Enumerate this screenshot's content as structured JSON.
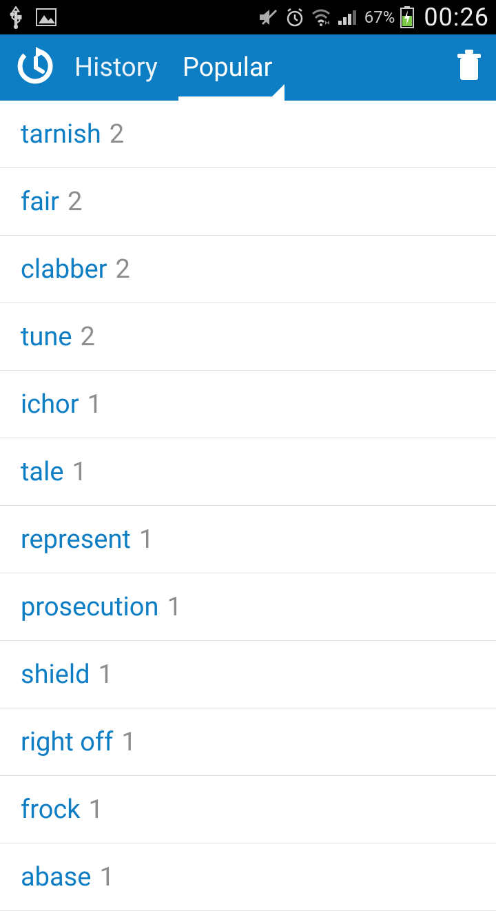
{
  "status": {
    "battery_percent": "67%",
    "time": "00:26"
  },
  "header": {
    "tabs": {
      "history": "History",
      "popular": "Popular"
    }
  },
  "list": [
    {
      "word": "tarnish",
      "count": "2"
    },
    {
      "word": "fair",
      "count": "2"
    },
    {
      "word": "clabber",
      "count": "2"
    },
    {
      "word": "tune",
      "count": "2"
    },
    {
      "word": "ichor",
      "count": "1"
    },
    {
      "word": "tale",
      "count": "1"
    },
    {
      "word": "represent",
      "count": "1"
    },
    {
      "word": "prosecution",
      "count": "1"
    },
    {
      "word": "shield",
      "count": "1"
    },
    {
      "word": "right off",
      "count": "1"
    },
    {
      "word": "frock",
      "count": "1"
    },
    {
      "word": "abase",
      "count": "1"
    }
  ]
}
